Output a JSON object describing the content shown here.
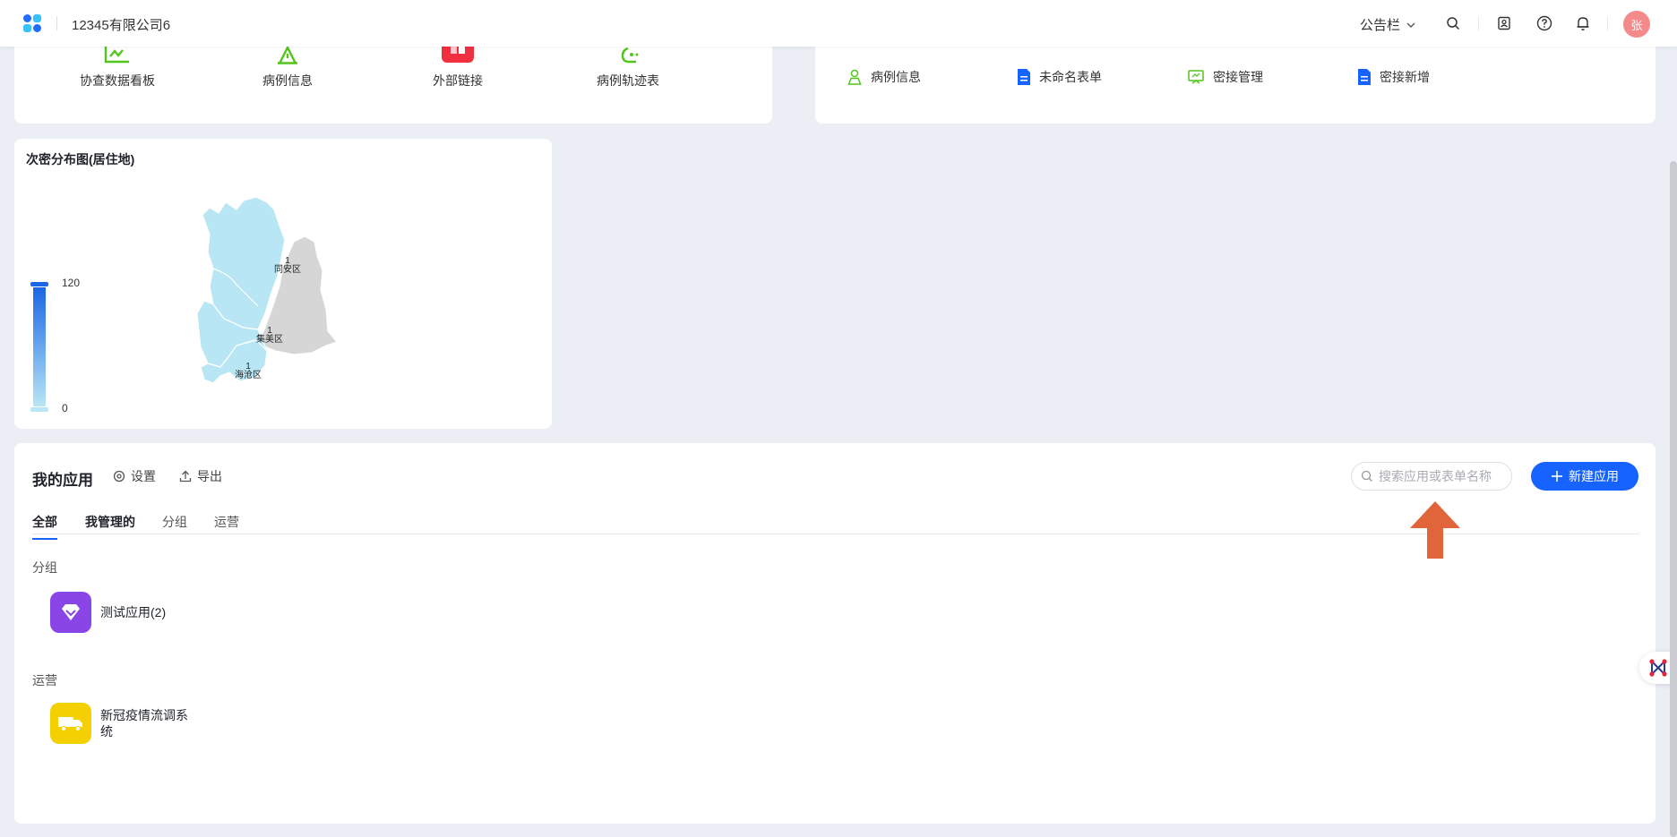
{
  "header": {
    "company": "12345有限公司6",
    "notice_label": "公告栏",
    "avatar_text": "张"
  },
  "quick_links": [
    {
      "label": "协查数据看板",
      "icon": "chart-icon",
      "color": "#52c41a"
    },
    {
      "label": "病例信息",
      "icon": "warning-triangle-icon",
      "color": "#52c41a"
    },
    {
      "label": "外部链接",
      "icon": "link-app-icon",
      "color": "#f0303e"
    },
    {
      "label": "病例轨迹表",
      "icon": "route-icon",
      "color": "#52c41a"
    }
  ],
  "recent_forms": [
    {
      "label": "病例信息",
      "icon": "person-icon",
      "color": "#52c41a"
    },
    {
      "label": "未命名表单",
      "icon": "document-icon",
      "color": "#1663ff"
    },
    {
      "label": "密接管理",
      "icon": "screen-icon",
      "color": "#52c41a"
    },
    {
      "label": "密接新增",
      "icon": "document-icon",
      "color": "#1663ff"
    }
  ],
  "map": {
    "title": "次密分布图(居住地)",
    "legend_max": "120",
    "legend_min": "0",
    "districts": [
      {
        "value": "1",
        "name": "同安区"
      },
      {
        "value": "1",
        "name": "集美区"
      },
      {
        "value": "1",
        "name": "海沧区"
      }
    ]
  },
  "apps": {
    "title": "我的应用",
    "settings_label": "设置",
    "export_label": "导出",
    "search_placeholder": "搜索应用或表单名称",
    "new_button_label": "新建应用",
    "tabs": [
      "全部",
      "我管理的",
      "分组",
      "运营"
    ],
    "groups": [
      {
        "label": "分组",
        "app_name": "测试应用(2)",
        "icon": "diamond-icon",
        "color": "#8a45e6"
      },
      {
        "label": "运营",
        "app_name": "新冠疫情流调系统",
        "icon": "truck-icon",
        "color": "#f5d000"
      }
    ]
  },
  "colors": {
    "primary": "#1663ff",
    "background": "#ebeef5",
    "annotation_arrow": "#e0653a"
  }
}
